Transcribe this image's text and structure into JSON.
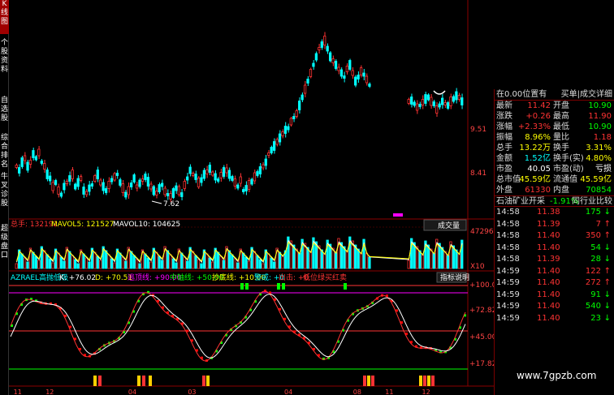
{
  "sidebar": {
    "tabs": [
      {
        "label": "K线图",
        "active": true
      },
      {
        "label": "个股资料",
        "active": false
      },
      {
        "label": "自选股",
        "active": false
      },
      {
        "label": "综合排名",
        "active": false
      },
      {
        "label": "牛叉诊股",
        "active": false
      },
      {
        "label": "超级盘口",
        "active": false
      }
    ]
  },
  "kline": {
    "price_labels": [
      "9.51",
      "8.41"
    ],
    "low_marker": "7.62"
  },
  "volume_panel": {
    "total": "总手: 132192",
    "mavol5": "MAVOL5: 121527",
    "mavol10": "MAVOL10: 104625",
    "button": "成交量",
    "scale_top": "47296",
    "scale_bottom": "X10"
  },
  "indicator_panel": {
    "name": "AZRAEL高抛低吸",
    "items": [
      {
        "text": "K: +76.02",
        "color": "#ffffff"
      },
      {
        "text": "D: +70.51",
        "color": "#ffff00"
      },
      {
        "text": "逃顶线: +90.00",
        "color": "#ff00ff"
      },
      {
        "text": "中轴线: +50.00",
        "color": "#00ff00"
      },
      {
        "text": "抄底线: +10.00",
        "color": "#ffff00"
      },
      {
        "text": "警戒: +0",
        "color": "#00ffff"
      },
      {
        "text": "出击: +0",
        "color": "#ff3333"
      },
      {
        "text": "低位绿买红卖",
        "color": "#ff3333"
      }
    ],
    "button": "指标说明",
    "scale": [
      "+100.0",
      "+72.82",
      "+45.00",
      "+17.82"
    ]
  },
  "axis": {
    "ticks": [
      {
        "label": "11",
        "frac": 0.01
      },
      {
        "label": "12",
        "frac": 0.08
      },
      {
        "label": "04",
        "frac": 0.26
      },
      {
        "label": "03",
        "frac": 0.39
      },
      {
        "label": "04",
        "frac": 0.6
      },
      {
        "label": "08",
        "frac": 0.75
      },
      {
        "label": "11",
        "frac": 0.82
      },
      {
        "label": "12",
        "frac": 0.9
      }
    ]
  },
  "quote": {
    "header": "在0.00位置有",
    "header_right": "买单|成交详细",
    "rows": [
      {
        "k1": "最新",
        "v1": "11.42",
        "c1": "#ff3333",
        "k2": "开盘",
        "v2": "10.90",
        "c2": "#00ff00"
      },
      {
        "k1": "涨跌",
        "v1": "+0.26",
        "c1": "#ff3333",
        "k2": "最高",
        "v2": "11.90",
        "c2": "#ff3333"
      },
      {
        "k1": "涨幅",
        "v1": "+2.33%",
        "c1": "#ff3333",
        "k2": "最低",
        "v2": "10.90",
        "c2": "#00ff00"
      },
      {
        "k1": "振幅",
        "v1": "8.96%",
        "c1": "#ffff00",
        "k2": "量比",
        "v2": "1.18",
        "c2": "#ff3333"
      },
      {
        "k1": "总手",
        "v1": "13.22万",
        "c1": "#ffff00",
        "k2": "换手",
        "v2": "3.31%",
        "c2": "#ffff00"
      },
      {
        "k1": "金额",
        "v1": "1.52亿",
        "c1": "#00ffff",
        "k2": "换手(实)",
        "v2": "4.80%",
        "c2": "#ffff00"
      },
      {
        "k1": "市盈",
        "v1": "40.05",
        "c1": "#ffffff",
        "k2": "市盈(动)",
        "v2": "亏损",
        "c2": "#ffffff"
      },
      {
        "k1": "总市值",
        "v1": "45.59亿",
        "c1": "#ffff00",
        "k2": "流通值",
        "v2": "45.59亿",
        "c2": "#ffff00"
      },
      {
        "k1": "外盘",
        "v1": "61330",
        "c1": "#ff3333",
        "k2": "内盘",
        "v2": "70854",
        "c2": "#00ff00"
      }
    ],
    "subheader": "石油矿业开采",
    "subheader_change": "-1.91%",
    "subheader_right": "同行业比较",
    "ticks": [
      {
        "time": "14:58",
        "price": "11.38",
        "vol": "175",
        "dir": "down"
      },
      {
        "time": "14:58",
        "price": "11.39",
        "vol": "7",
        "dir": "up"
      },
      {
        "time": "14:58",
        "price": "11.40",
        "vol": "350",
        "dir": "up"
      },
      {
        "time": "14:58",
        "price": "11.40",
        "vol": "54",
        "dir": "down"
      },
      {
        "time": "14:58",
        "price": "11.39",
        "vol": "28",
        "dir": "down"
      },
      {
        "time": "14:59",
        "price": "11.40",
        "vol": "122",
        "dir": "up"
      },
      {
        "time": "14:59",
        "price": "11.40",
        "vol": "272",
        "dir": "up"
      },
      {
        "time": "14:59",
        "price": "11.40",
        "vol": "91",
        "dir": "down"
      },
      {
        "time": "14:59",
        "price": "11.40",
        "vol": "540",
        "dir": "down"
      },
      {
        "time": "14:59",
        "price": "11.40",
        "vol": "23",
        "dir": "down"
      }
    ]
  },
  "watermark": "www.7gpzb.com"
}
